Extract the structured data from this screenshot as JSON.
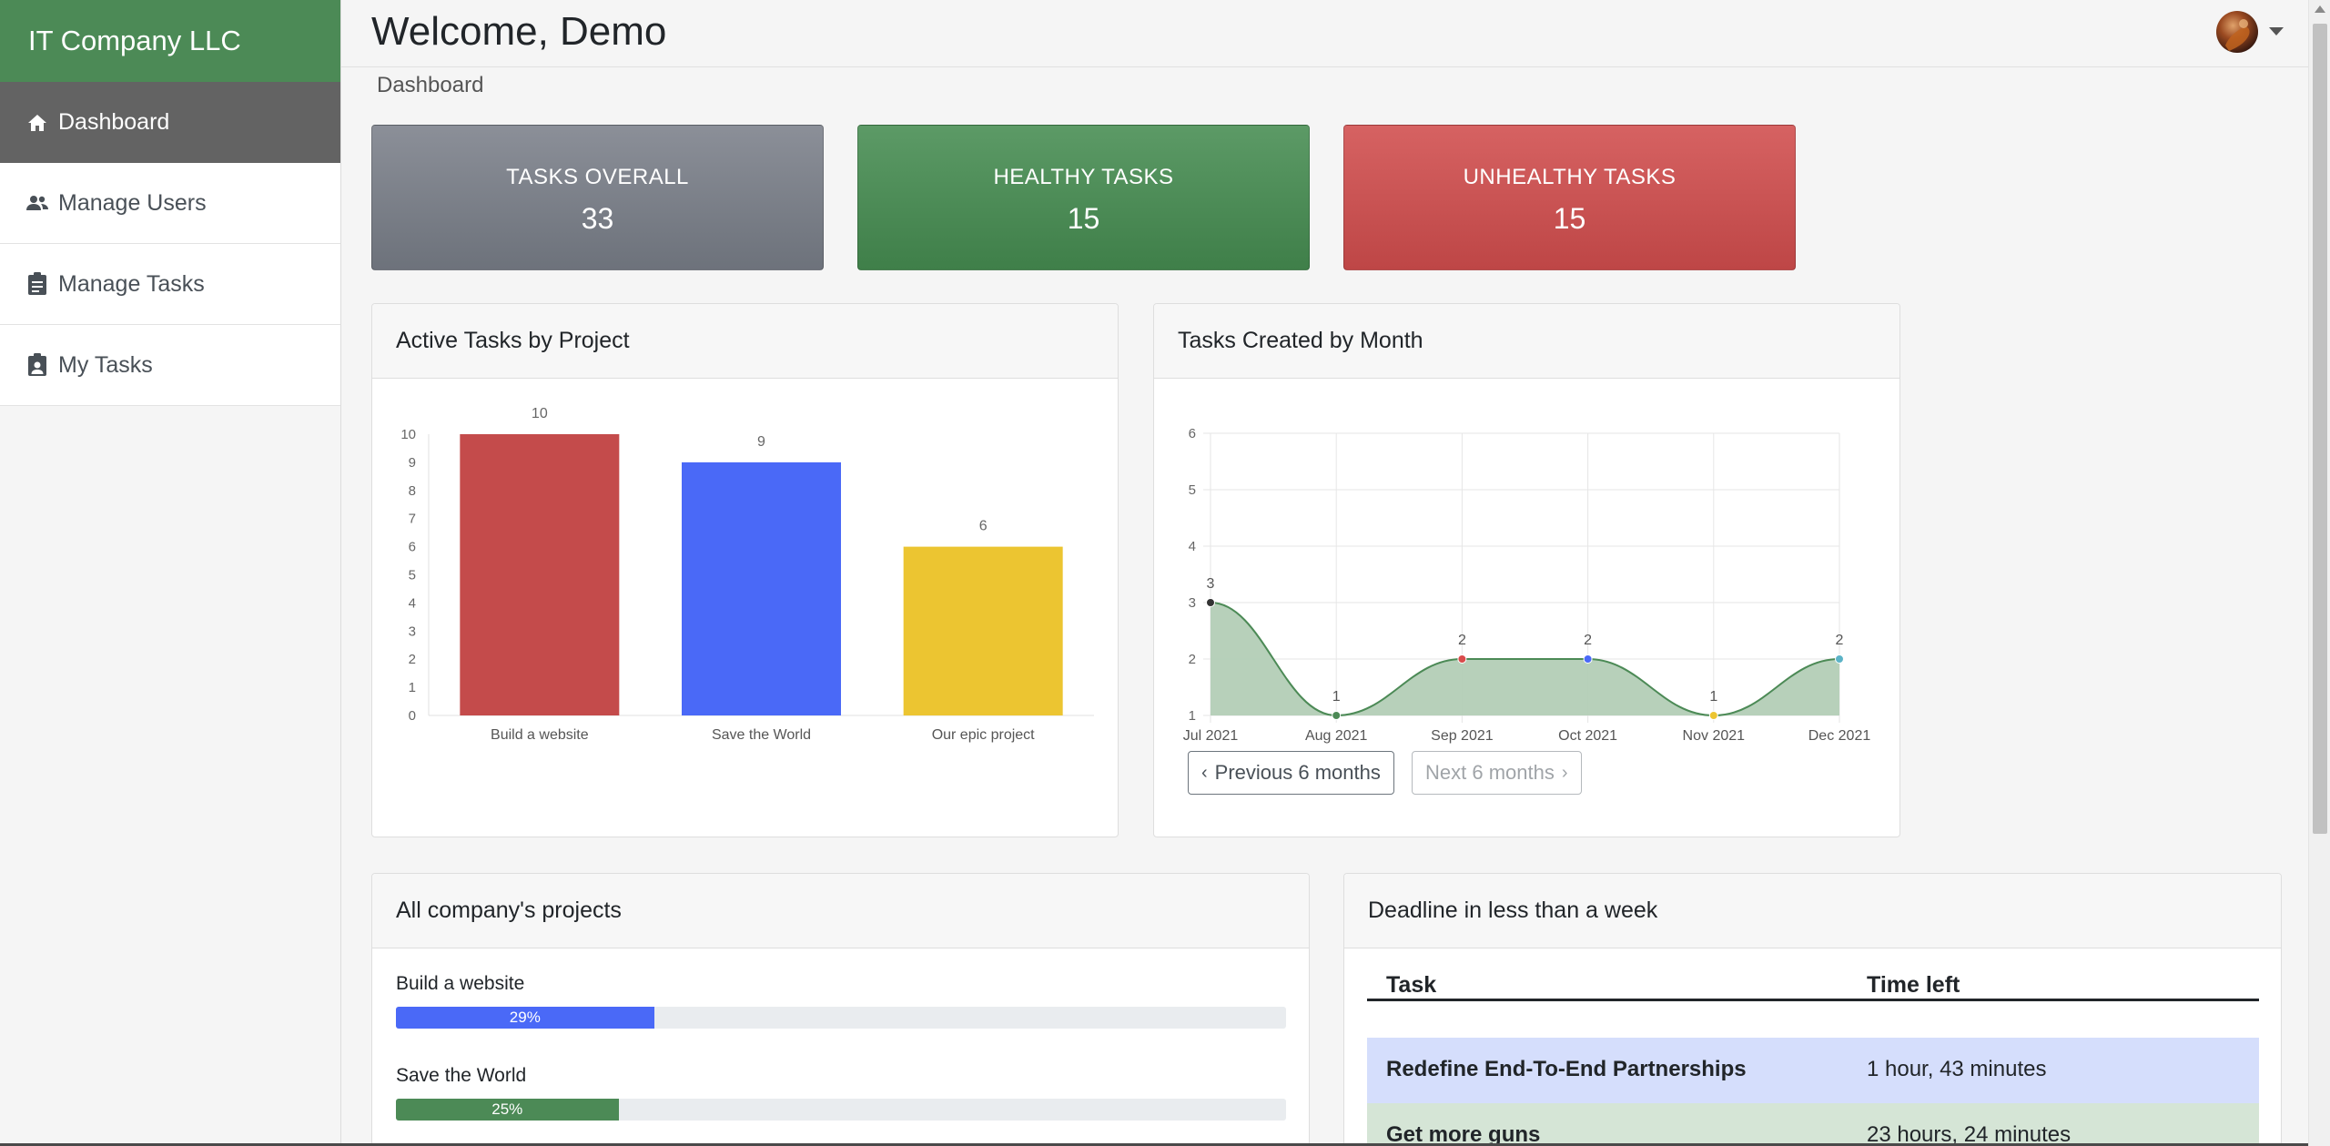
{
  "app": {
    "brand": "IT Company LLC"
  },
  "sidebar": {
    "items": [
      {
        "label": "Dashboard",
        "icon": "home-icon",
        "active": true
      },
      {
        "label": "Manage Users",
        "icon": "users-icon",
        "active": false
      },
      {
        "label": "Manage Tasks",
        "icon": "clipboard-icon",
        "active": false
      },
      {
        "label": "My Tasks",
        "icon": "clipboard-user-icon",
        "active": false
      }
    ]
  },
  "header": {
    "welcome": "Welcome, Demo",
    "breadcrumb": "Dashboard"
  },
  "stats": [
    {
      "label": "TASKS OVERALL",
      "value": "33",
      "color": "#7b8089"
    },
    {
      "label": "HEALTHY TASKS",
      "value": "15",
      "color": "#4c8a56"
    },
    {
      "label": "UNHEALTHY TASKS",
      "value": "15",
      "color": "#c85353"
    }
  ],
  "bar_card": {
    "title": "Active Tasks by Project"
  },
  "line_card": {
    "title": "Tasks Created by Month",
    "prev_label": "Previous 6 months",
    "next_label": "Next 6 months"
  },
  "chart_data": [
    {
      "type": "bar",
      "title": "Active Tasks by Project",
      "categories": [
        "Build a website",
        "Save the World",
        "Our epic project"
      ],
      "values": [
        10,
        9,
        6
      ],
      "colors": [
        "#c44b4b",
        "#4a69f7",
        "#ecc531"
      ],
      "data_labels": [
        "10",
        "9",
        "6"
      ],
      "ylim": [
        0,
        10
      ],
      "yticks": [
        "0",
        "1",
        "2",
        "3",
        "4",
        "5",
        "6",
        "7",
        "8",
        "9",
        "10"
      ],
      "grid": false,
      "legend": "none"
    },
    {
      "type": "area",
      "title": "Tasks Created by Month",
      "x": [
        "Jul 2021",
        "Aug 2021",
        "Sep 2021",
        "Oct 2021",
        "Nov 2021",
        "Dec 2021"
      ],
      "values": [
        3,
        1,
        2,
        2,
        1,
        2
      ],
      "data_labels": [
        "3",
        "1",
        "2",
        "2",
        "1",
        "2"
      ],
      "point_colors": [
        "#333333",
        "#4c8a56",
        "#d94b4b",
        "#4a69f7",
        "#ecc531",
        "#5cb3c7"
      ],
      "fill_color": "#b3cdb6",
      "line_color": "#4c8a56",
      "ylim": [
        1,
        6
      ],
      "yticks": [
        "1",
        "2",
        "3",
        "4",
        "5",
        "6"
      ],
      "grid": true,
      "legend": "none"
    }
  ],
  "projects": {
    "title": "All company's projects",
    "items": [
      {
        "name": "Build a website",
        "percent": 29,
        "label": "29%",
        "color": "#4a69f7"
      },
      {
        "name": "Save the World",
        "percent": 25,
        "label": "25%",
        "color": "#4c8a56"
      }
    ]
  },
  "deadline": {
    "title": "Deadline in less than a week",
    "columns": [
      "Task",
      "Time left"
    ],
    "rows": [
      {
        "task": "Redefine End-To-End Partnerships",
        "time": "1 hour, 43 minutes",
        "color": "#d5defc"
      },
      {
        "task": "Get more guns",
        "time": "23 hours, 24 minutes",
        "color": "#d5e5d6"
      }
    ]
  }
}
